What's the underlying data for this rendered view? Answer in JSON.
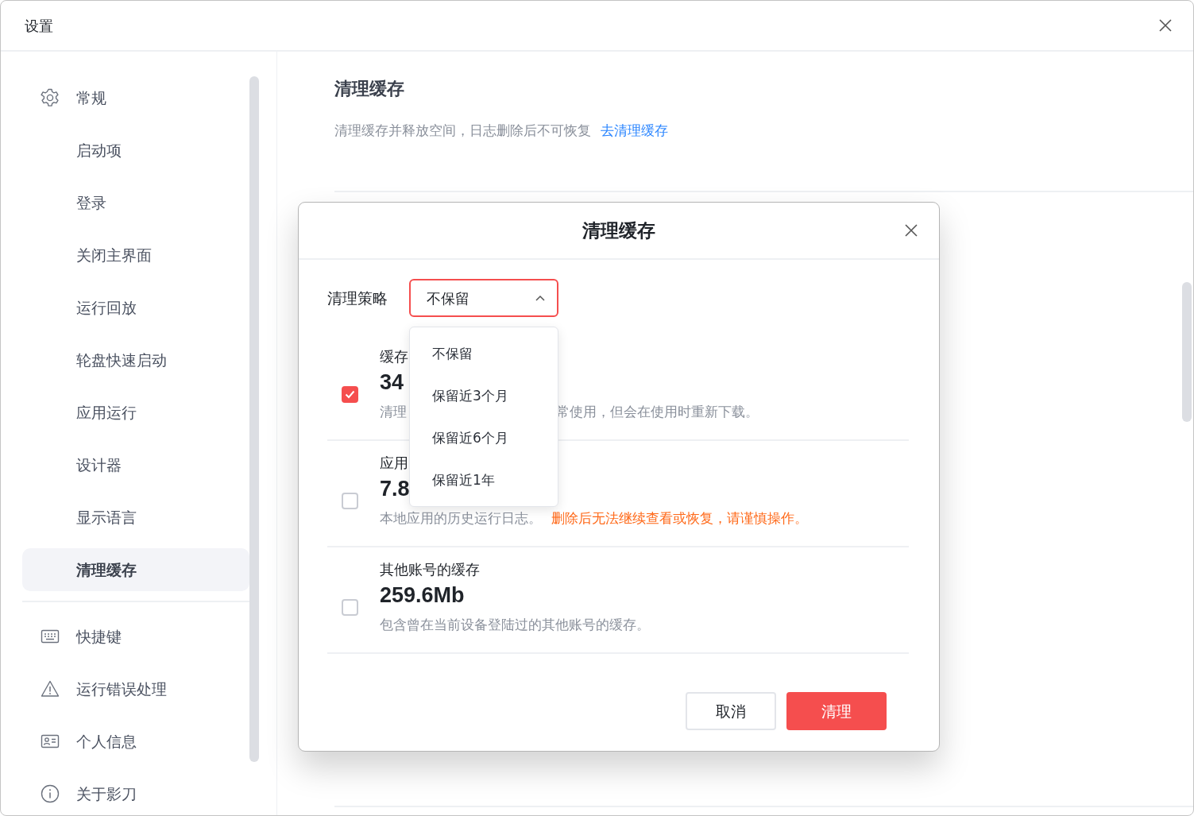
{
  "window": {
    "title": "设置"
  },
  "sidebar": {
    "groups": [
      {
        "items": [
          {
            "label": "常规",
            "kind": "section",
            "selected": false
          },
          {
            "label": "启动项",
            "kind": "entry",
            "selected": false
          },
          {
            "label": "登录",
            "kind": "entry",
            "selected": false
          },
          {
            "label": "关闭主界面",
            "kind": "entry",
            "selected": false
          },
          {
            "label": "运行回放",
            "kind": "entry",
            "selected": false
          },
          {
            "label": "轮盘快速启动",
            "kind": "entry",
            "selected": false
          },
          {
            "label": "应用运行",
            "kind": "entry",
            "selected": false
          },
          {
            "label": "设计器",
            "kind": "entry",
            "selected": false
          },
          {
            "label": "显示语言",
            "kind": "entry",
            "selected": false
          },
          {
            "label": "清理缓存",
            "kind": "entry",
            "selected": true
          }
        ]
      },
      {
        "items": [
          {
            "label": "快捷键",
            "kind": "section",
            "selected": false
          },
          {
            "label": "运行错误处理",
            "kind": "section",
            "selected": false
          },
          {
            "label": "个人信息",
            "kind": "section",
            "selected": false
          },
          {
            "label": "关于影刀",
            "kind": "section",
            "selected": false
          }
        ]
      }
    ]
  },
  "page": {
    "title": "清理缓存",
    "description": "清理缓存并释放空间，日志删除后不可恢复",
    "link": "去清理缓存"
  },
  "dialog": {
    "title": "清理缓存",
    "strategy": {
      "label": "清理策略",
      "value": "不保留",
      "expanded": true,
      "options": [
        "不保留",
        "保留近3个月",
        "保留近6个月",
        "保留近1年"
      ]
    },
    "items": [
      {
        "title": "缓存",
        "size": "34",
        "description": "清理",
        "description_after": "常使用，但会在使用时重新下载。",
        "checked": true
      },
      {
        "title": "应用",
        "size": "7.8",
        "description": "本地应用的历史运行日志。",
        "warning": "删除后无法继续查看或恢复，请谨慎操作。",
        "checked": false
      },
      {
        "title": "其他账号的缓存",
        "size": "259.6Mb",
        "description": "包含曾在当前设备登陆过的其他账号的缓存。",
        "checked": false
      }
    ],
    "buttons": [
      {
        "label": "取消",
        "kind": "secondary"
      },
      {
        "label": "清理",
        "kind": "primary"
      }
    ]
  }
}
